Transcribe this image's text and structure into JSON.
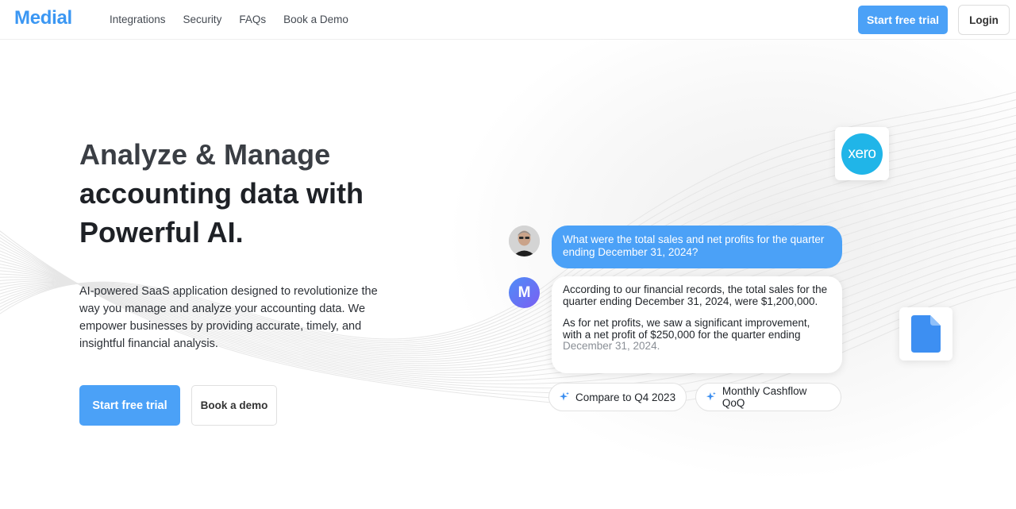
{
  "header": {
    "logo": "Medial",
    "nav": [
      "Integrations",
      "Security",
      "FAQs",
      "Book a Demo"
    ],
    "start_trial": "Start free trial",
    "login": "Login"
  },
  "hero": {
    "title_line1": "Analyze & Manage",
    "title_line2": "accounting data with",
    "title_line3": "Powerful AI.",
    "description": "AI-powered SaaS application designed to revolutionize the way you manage and analyze your accounting data.  We empower businesses by providing accurate, timely, and insightful financial analysis.",
    "cta_trial": "Start free trial",
    "cta_demo": "Book a demo"
  },
  "chat": {
    "xero_label": "xero",
    "avatar_letter": "M",
    "question": "What were the total sales and net profits for the quarter ending December 31, 2024?",
    "answer_p1": "According to our financial records, the total sales for the quarter ending December 31, 2024, were $1,200,000.",
    "answer_p2": "As for net profits, we saw a significant improvement, with a net profit of $250,000 for the quarter ending",
    "answer_p2_fade": "December 31, 2024.",
    "suggestions": [
      "Compare to Q4 2023",
      "Monthly Cashflow QoQ"
    ]
  },
  "colors": {
    "brand": "#3b97f3",
    "primary_button": "#4ba1f7",
    "xero": "#20b5e8",
    "avatar_gradient": [
      "#4e8df7",
      "#7b5ff2"
    ]
  },
  "icons": [
    "user-avatar",
    "xero-logo",
    "file-icon",
    "sparkle-icon"
  ]
}
